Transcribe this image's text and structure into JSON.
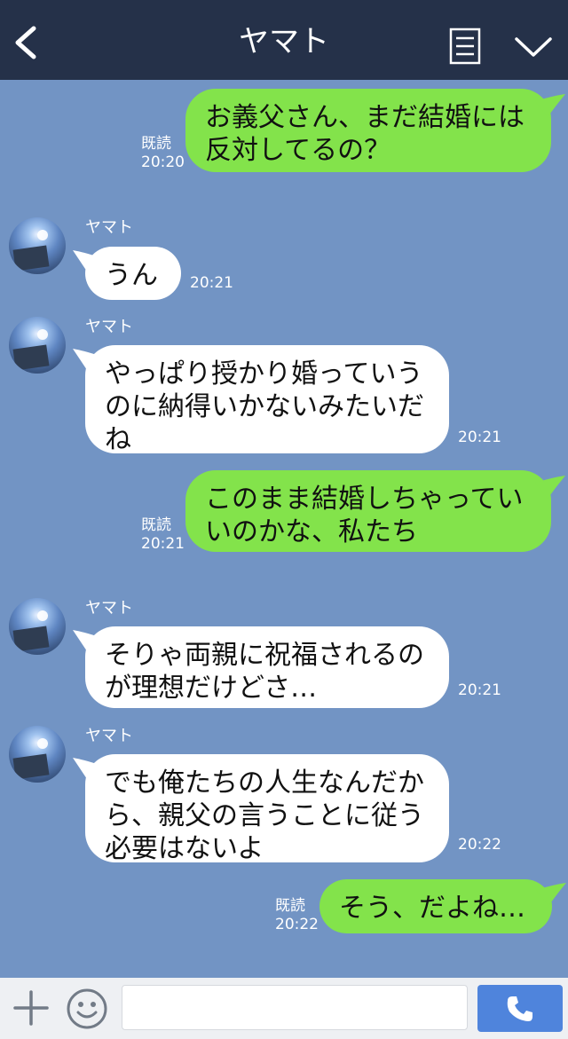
{
  "header": {
    "title": "ヤマト",
    "icons": [
      "back-chevron-icon",
      "menu-list-icon",
      "chevron-down-icon"
    ],
    "color": "#253149"
  },
  "chat": {
    "background": "#7294c4",
    "messages": [
      {
        "from": "me",
        "text_lines": [
          "お義父さん、まだ結婚には",
          "反対してるの？"
        ],
        "read": "既読",
        "time": "20:20"
      },
      {
        "from": "them",
        "name": "ヤマト",
        "text_lines": [
          "うん"
        ],
        "time": "20:21"
      },
      {
        "from": "them",
        "name": "ヤマト",
        "text_lines": [
          "やっぱり授かり婚っていう",
          "のに納得いかないみたいだ",
          "ね"
        ],
        "time": "20:21"
      },
      {
        "from": "me",
        "text_lines": [
          "このまま結婚しちゃってい",
          "いのかな、私たち"
        ],
        "read": "既読",
        "time": "20:21"
      },
      {
        "from": "them",
        "name": "ヤマト",
        "text_lines": [
          "そりゃ両親に祝福されるの",
          "が理想だけどさ…"
        ],
        "time": "20:21"
      },
      {
        "from": "them",
        "name": "ヤマト",
        "text_lines": [
          "でも俺たちの人生なんだか",
          "ら、親父の言うことに従う",
          "必要はないよ"
        ],
        "time": "20:22"
      },
      {
        "from": "me",
        "text_lines": [
          "そう、だよね…"
        ],
        "read": "既読",
        "time": "20:22"
      }
    ],
    "bubble_colors": {
      "me": "#83e34b",
      "them": "#ffffff"
    }
  },
  "composer": {
    "icons": [
      "plus-icon",
      "emoji-icon",
      "phone-icon"
    ],
    "input_value": "",
    "call_button_color": "#4f84dc"
  }
}
